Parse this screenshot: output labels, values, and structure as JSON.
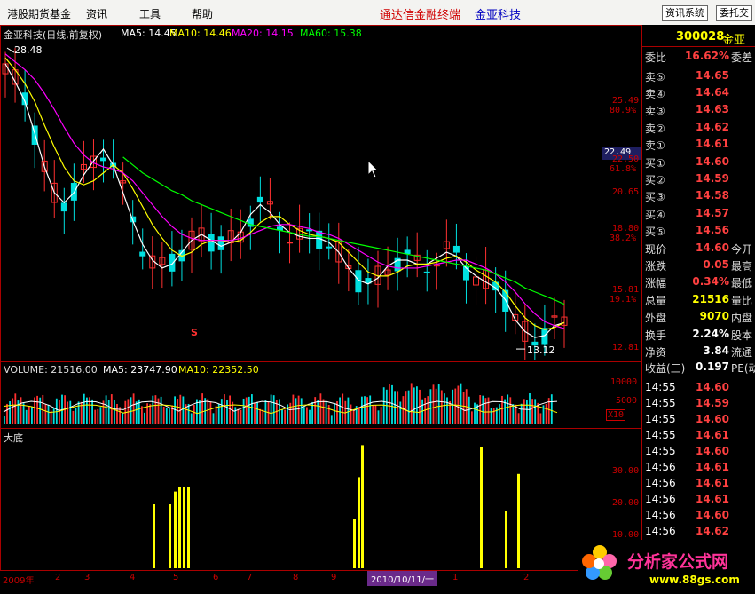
{
  "menu": {
    "items": [
      "港股期货基金",
      "资讯",
      "工具",
      "帮助"
    ],
    "app_title": "通达信金融终端",
    "stock_title": "金亚科技",
    "btn_news": "资讯系统",
    "btn_trust": "委托交"
  },
  "chart_header": {
    "name": "金亚科技(日线,前复权)",
    "ma5": "MA5: 14.45",
    "ma10": "MA10: 14.46",
    "ma20": "MA20: 14.15",
    "ma60": "MA60: 15.38"
  },
  "annotations": {
    "high": "28.48",
    "low": "13.12",
    "cursor_price": "22.49",
    "marker": "S"
  },
  "price_axis": [
    {
      "v": "25.49",
      "p": "80.9%"
    },
    {
      "v": "22.50",
      "p": "61.8%"
    },
    {
      "v": "20.65",
      "p": ""
    },
    {
      "v": "18.80",
      "p": "38.2%"
    },
    {
      "v": "15.81",
      "p": "19.1%"
    },
    {
      "v": "12.81",
      "p": ""
    }
  ],
  "volume_header": {
    "vol": "VOLUME: 21516.00",
    "ma5": "MA5: 23747.90",
    "ma10": "MA10: 22352.50"
  },
  "volume_axis": [
    "10000",
    "5000",
    "X10"
  ],
  "ind_header": "大底",
  "ind_axis": [
    "30.00",
    "20.00",
    "10.00"
  ],
  "date_axis": [
    "2009年",
    "2",
    "3",
    "4",
    "5",
    "6",
    "7",
    "8",
    "9",
    "2010/10/11/一",
    "1",
    "2"
  ],
  "side": {
    "code": "300028",
    "name": "金亚",
    "weibi_label": "委比",
    "weibi": "16.62%",
    "weicha_label": "委差",
    "sells": [
      {
        "label": "卖⑤",
        "price": "14.65"
      },
      {
        "label": "卖④",
        "price": "14.64"
      },
      {
        "label": "卖③",
        "price": "14.63"
      },
      {
        "label": "卖②",
        "price": "14.62"
      },
      {
        "label": "卖①",
        "price": "14.61"
      }
    ],
    "buys": [
      {
        "label": "买①",
        "price": "14.60"
      },
      {
        "label": "买②",
        "price": "14.59"
      },
      {
        "label": "买③",
        "price": "14.58"
      },
      {
        "label": "买④",
        "price": "14.57"
      },
      {
        "label": "买⑤",
        "price": "14.56"
      }
    ],
    "stats": [
      {
        "label": "现价",
        "value": "14.60",
        "right": "今开",
        "color": "#ff4040"
      },
      {
        "label": "涨跌",
        "value": "0.05",
        "right": "最高",
        "color": "#ff4040"
      },
      {
        "label": "涨幅",
        "value": "0.34%",
        "right": "最低",
        "color": "#ff4040"
      },
      {
        "label": "总量",
        "value": "21516",
        "right": "量比",
        "color": "#ffff00"
      },
      {
        "label": "外盘",
        "value": "9070",
        "right": "内盘",
        "color": "#ffff00"
      }
    ],
    "stats2": [
      {
        "label": "换手",
        "value": "2.24%",
        "right": "股本"
      },
      {
        "label": "净资",
        "value": "3.84",
        "right": "流通"
      },
      {
        "label": "收益(三)",
        "value": "0.197",
        "right": "PE(动)"
      }
    ],
    "ticks": [
      {
        "t": "14:55",
        "p": "14.60"
      },
      {
        "t": "14:55",
        "p": "14.59"
      },
      {
        "t": "14:55",
        "p": "14.60"
      },
      {
        "t": "14:55",
        "p": "14.61"
      },
      {
        "t": "14:55",
        "p": "14.60"
      },
      {
        "t": "14:56",
        "p": "14.61"
      },
      {
        "t": "14:56",
        "p": "14.61"
      },
      {
        "t": "14:56",
        "p": "14.61"
      },
      {
        "t": "14:56",
        "p": "14.60"
      },
      {
        "t": "14:56",
        "p": "14.62"
      },
      {
        "t": "14:56",
        "p": "14.61"
      }
    ]
  },
  "logo": {
    "text": "分析家公式网",
    "url": "www.88gs.com"
  },
  "colors": {
    "up": "#ff3030",
    "down": "#00e0e0",
    "ma5": "#ffffff",
    "ma10": "#ffff00",
    "ma20": "#ff00ff",
    "ma60": "#00ff00"
  },
  "chart_data": {
    "type": "line",
    "title": "金亚科技(日线,前复权)",
    "price_range": [
      12.81,
      28.48
    ],
    "series": [
      {
        "name": "MA5",
        "values": [
          27.5,
          26.6,
          25.6,
          24.0,
          22.3,
          21.0,
          20.5,
          21.0,
          21.9,
          22.6,
          23.2,
          22.4,
          21.0,
          19.6,
          18.4,
          17.6,
          17.2,
          17.4,
          18.0,
          18.6,
          18.9,
          18.6,
          18.3,
          18.5,
          19.0,
          19.9,
          20.4,
          20.0,
          19.4,
          19.0,
          18.8,
          18.7,
          18.7,
          18.5,
          18.0,
          17.2,
          16.6,
          16.4,
          16.7,
          17.3,
          17.6,
          17.6,
          17.4,
          17.4,
          17.7,
          18.0,
          17.8,
          17.2,
          16.8,
          16.5,
          16.2,
          15.6,
          14.6,
          14.0,
          13.7,
          13.8,
          14.3,
          14.45
        ]
      },
      {
        "name": "MA10",
        "values": [
          27.8,
          27.2,
          26.5,
          25.6,
          24.4,
          23.3,
          22.3,
          21.6,
          21.4,
          21.6,
          22.0,
          22.4,
          22.0,
          21.2,
          20.3,
          19.4,
          18.7,
          18.1,
          17.8,
          18.0,
          18.4,
          18.6,
          18.6,
          18.5,
          18.6,
          19.0,
          19.5,
          19.8,
          19.8,
          19.4,
          19.1,
          18.9,
          18.8,
          18.7,
          18.5,
          18.0,
          17.5,
          17.0,
          16.8,
          16.8,
          17.0,
          17.3,
          17.4,
          17.4,
          17.5,
          17.7,
          17.8,
          17.5,
          17.1,
          16.8,
          16.5,
          16.0,
          15.3,
          14.7,
          14.3,
          14.1,
          14.2,
          14.46
        ]
      },
      {
        "name": "MA20",
        "values": [
          28.0,
          27.6,
          27.2,
          26.7,
          26.0,
          25.2,
          24.3,
          23.5,
          22.9,
          22.5,
          22.3,
          22.2,
          22.0,
          21.6,
          21.0,
          20.4,
          19.8,
          19.3,
          18.9,
          18.7,
          18.6,
          18.6,
          18.6,
          18.6,
          18.7,
          18.9,
          19.1,
          19.3,
          19.4,
          19.4,
          19.3,
          19.2,
          19.0,
          18.9,
          18.7,
          18.4,
          18.1,
          17.8,
          17.5,
          17.3,
          17.2,
          17.2,
          17.2,
          17.3,
          17.4,
          17.5,
          17.6,
          17.6,
          17.4,
          17.2,
          16.9,
          16.5,
          16.0,
          15.4,
          14.9,
          14.5,
          14.3,
          14.15
        ]
      },
      {
        "name": "MA60",
        "values": [
          null,
          null,
          null,
          null,
          null,
          null,
          null,
          null,
          null,
          null,
          null,
          null,
          22.8,
          22.4,
          22.0,
          21.7,
          21.4,
          21.1,
          20.9,
          20.6,
          20.4,
          20.2,
          20.0,
          19.8,
          19.6,
          19.4,
          19.3,
          19.2,
          19.1,
          19.0,
          18.9,
          18.8,
          18.8,
          18.7,
          18.6,
          18.5,
          18.4,
          18.3,
          18.2,
          18.1,
          18.0,
          17.9,
          17.8,
          17.7,
          17.6,
          17.5,
          17.4,
          17.3,
          17.2,
          17.1,
          16.9,
          16.7,
          16.5,
          16.2,
          16.0,
          15.8,
          15.6,
          15.38
        ]
      }
    ],
    "indicator": {
      "name": "大底",
      "ylim": [
        0,
        40
      ],
      "bars": [
        {
          "i": 19,
          "v": 20.0
        },
        {
          "i": 21,
          "v": 20.0
        },
        {
          "i": 22,
          "v": 24.0
        },
        {
          "i": 23,
          "v": 25.5
        },
        {
          "i": 24,
          "v": 25.5
        },
        {
          "i": 26,
          "v": 25.5
        },
        {
          "i": 44,
          "v": 15.5
        },
        {
          "i": 45,
          "v": 28.5
        },
        {
          "i": 46,
          "v": 38.5
        },
        {
          "i": 62,
          "v": 38.0
        },
        {
          "i": 65,
          "v": 18.0
        },
        {
          "i": 67,
          "v": 29.5
        }
      ]
    }
  }
}
